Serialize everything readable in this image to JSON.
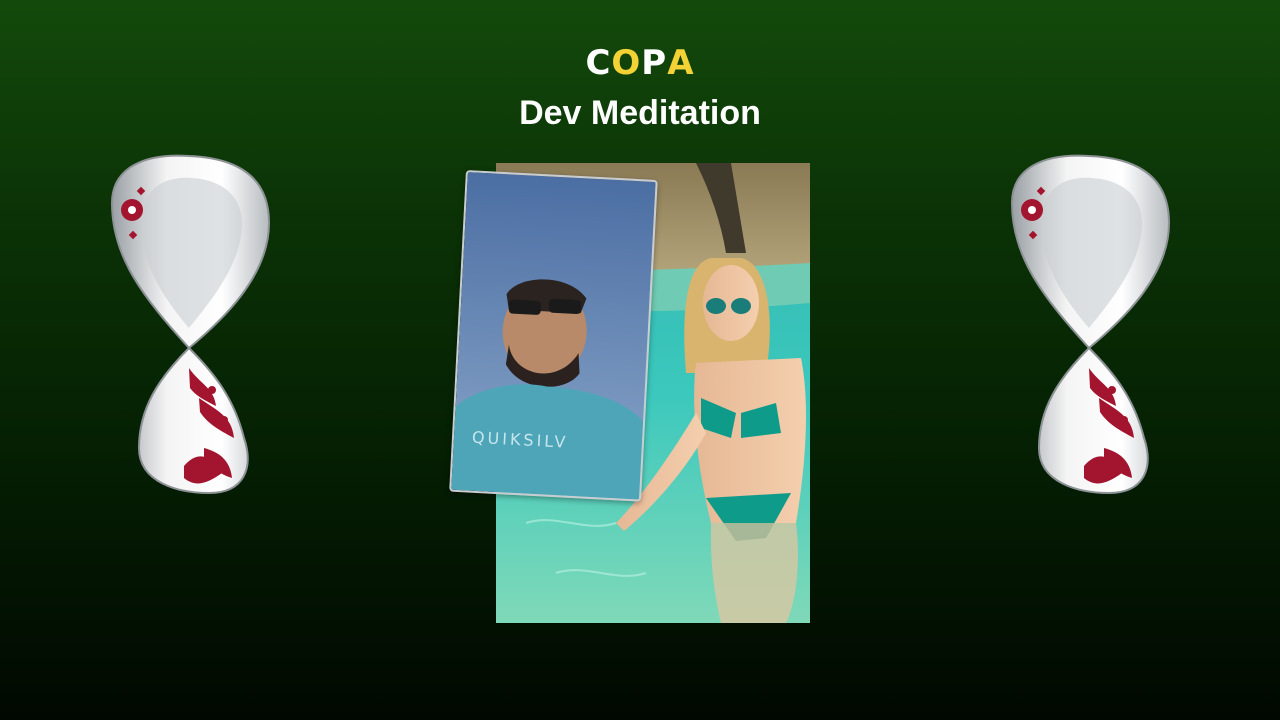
{
  "header": {
    "logo": {
      "letters": [
        "C",
        "O",
        "P",
        "A"
      ],
      "colors": [
        "#ffffff",
        "#f2d234",
        "#ffffff",
        "#f2d234"
      ]
    },
    "title": "Dev Meditation"
  },
  "emblems": {
    "left": "world-cup-trophy-emblem",
    "right": "world-cup-trophy-emblem"
  },
  "photo": {
    "inset_shirt_text": "QUIKSILV"
  },
  "colors": {
    "background_top": "#134a0b",
    "background_bottom": "#010801",
    "accent": "#f2d234",
    "emblem_red": "#a3142e"
  }
}
